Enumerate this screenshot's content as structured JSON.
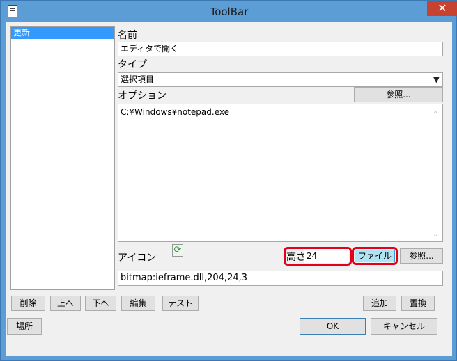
{
  "window": {
    "title": "ToolBar",
    "close_glyph": "✕"
  },
  "list": {
    "items": [
      "更新"
    ]
  },
  "name": {
    "label": "名前",
    "value": "エディタで開く"
  },
  "type": {
    "label": "タイプ",
    "value": "選択項目"
  },
  "option": {
    "label": "オプション",
    "browse_label": "参照...",
    "value": "C:¥Windows¥notepad.exe"
  },
  "icon": {
    "label": "アイコン",
    "preview_icon": "refresh-icon",
    "value": "bitmap:ieframe.dll,204,24,3"
  },
  "height": {
    "label": "高さ",
    "value": "24"
  },
  "file_button": "ファイル",
  "icon_browse_label": "参照...",
  "buttons": {
    "delete": "削除",
    "up": "上へ",
    "down": "下へ",
    "edit": "編集",
    "test": "テスト",
    "add": "追加",
    "replace": "置換",
    "location": "場所",
    "ok": "OK",
    "cancel": "キャンセル"
  },
  "colors": {
    "highlight": "#e3001b",
    "selection": "#3399ff",
    "title_bar": "#5d9dd6"
  }
}
